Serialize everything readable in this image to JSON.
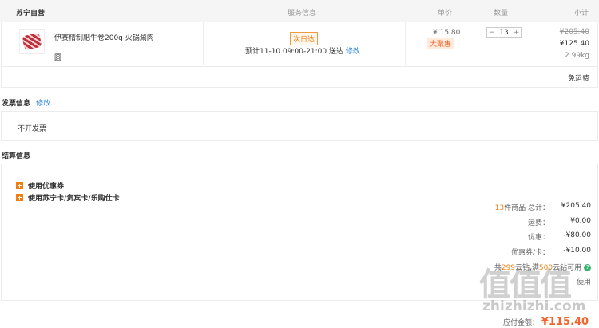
{
  "header": {
    "store": "苏宁自营",
    "service": "服务信息",
    "unit_price": "单价",
    "quantity": "数量",
    "subtotal": "小计"
  },
  "product": {
    "name_line1": "伊赛精制肥牛卷200g 火锅涮肉",
    "name_line2": "圆",
    "tag_next_day": "次日达",
    "delivery_text": "预计11-10 09:00-21:00 送达",
    "delivery_edit": "修改",
    "unit_price": "¥ 15.80",
    "promo_tag": "大聚惠",
    "qty": "13",
    "qty_minus": "−",
    "qty_plus": "+",
    "original_total": "¥205.40",
    "subtotal": "¥125.40",
    "weight": "2.99kg"
  },
  "shipping": {
    "label": "免运费"
  },
  "invoice": {
    "title": "发票信息",
    "edit": "修改",
    "value": "不开发票"
  },
  "settlement": {
    "title": "结算信息",
    "options": [
      "使用优惠券",
      "使用苏宁卡/贵宾卡/乐购仕卡"
    ],
    "summary": {
      "count": "13",
      "count_suffix": "件商品 总计：",
      "total": "¥205.40",
      "shipping_label": "运费：",
      "shipping": "¥0.00",
      "discount_label": "优惠：",
      "discount": "-¥80.00",
      "coupon_label": "优惠券/卡：",
      "coupon": "-¥10.00",
      "yunzuan_pre": "共",
      "yunzuan_a": "299",
      "yunzuan_mid": "云钻,满",
      "yunzuan_b": "500",
      "yunzuan_post": "云钻可用",
      "use_label": "使用"
    },
    "payable_label": "应付金额：",
    "payable": "¥115.40"
  },
  "watermark": {
    "mark": "值值值",
    "site": "zhizhizhi.com"
  },
  "colors": {
    "accent": "#f07f12",
    "link": "#2e86de",
    "price": "#f0642d"
  }
}
